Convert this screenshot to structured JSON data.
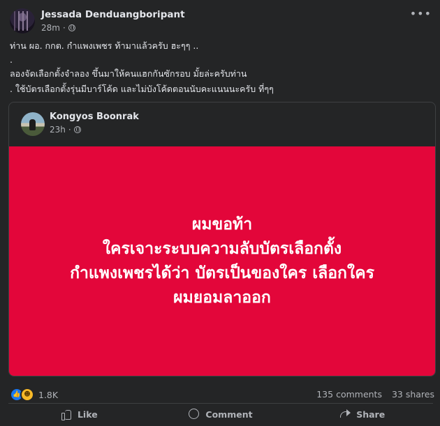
{
  "post": {
    "author": "Jessada Denduangboripant",
    "time": "28m",
    "more_icon": "more-horizontal-icon",
    "privacy_icon": "globe-icon",
    "text_lines": [
      "ท่าน ผอ. กกต. กำแพงเพชร ท้ามาแล้วครับ ฮะๆๆ ..",
      ".",
      " ลองจัดเลือกตั้งจำลอง ขึ้นมาให้คนแฮกกันซักรอบ มั้ยล่ะครับท่าน",
      ". ใช้บัตรเลือกตั้งรุ่นมีบาร์โค้ด และไม่บังโค้ดตอนนับคะแนนนะครับ ที่ๆๆ"
    ]
  },
  "shared": {
    "author": "Kongyos Boonrak",
    "time": "23h",
    "privacy_icon": "globe-icon",
    "background_color": "#e3063a",
    "lines": [
      "ผมขอท้า",
      "ใครเจาะระบบความลับบัตรเลือกตั้ง",
      "กำแพงเพชรได้ว่า บัตรเป็นของใคร เลือกใคร",
      "ผมยอมลาออก"
    ]
  },
  "stats": {
    "reactions_count": "1.8K",
    "comments": "135 comments",
    "shares": "33 shares"
  },
  "actions": {
    "like": "Like",
    "comment": "Comment",
    "share": "Share"
  },
  "colors": {
    "background": "#242526",
    "text": "#e4e6eb",
    "secondary": "#b0b3b8",
    "accent_red": "#e3063a",
    "like_blue": "#1877f2"
  }
}
